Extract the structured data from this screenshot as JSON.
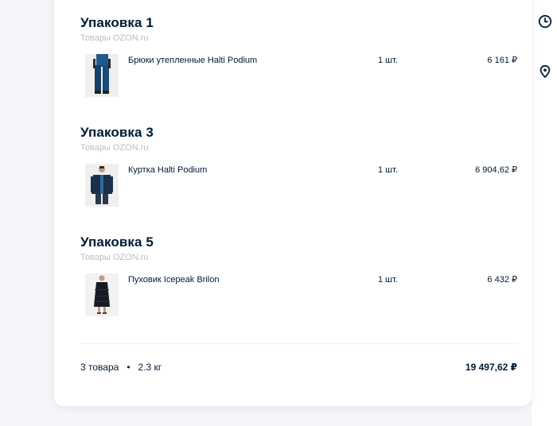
{
  "packages": [
    {
      "title": "Упаковка 1",
      "seller": "Товары OZON.ru",
      "item": {
        "name": "Брюки утепленные Halti Podium",
        "qty": "1 шт.",
        "price": "6 161 ₽",
        "image": "blue-ski-pants-photo"
      }
    },
    {
      "title": "Упаковка 3",
      "seller": "Товары OZON.ru",
      "item": {
        "name": "Куртка Halti Podium",
        "qty": "1 шт.",
        "price": "6 904,62 ₽",
        "image": "navy-jacket-photo"
      }
    },
    {
      "title": "Упаковка 5",
      "seller": "Товары OZON.ru",
      "item": {
        "name": "Пуховик Icepeak Brilon",
        "qty": "1 шт.",
        "price": "6 432 ₽",
        "image": "black-down-coat-photo"
      }
    }
  ],
  "summary": {
    "count": "3 товара",
    "separator": "•",
    "weight": "2.3 кг",
    "total": "19 497,62 ₽"
  },
  "side_icons": [
    "clock-icon",
    "location-pin-icon"
  ],
  "colors": {
    "background": "#f4f6f9",
    "card": "#ffffff",
    "text": "#001a34",
    "muted": "#b7bfc9",
    "divider": "#eef0f3"
  }
}
